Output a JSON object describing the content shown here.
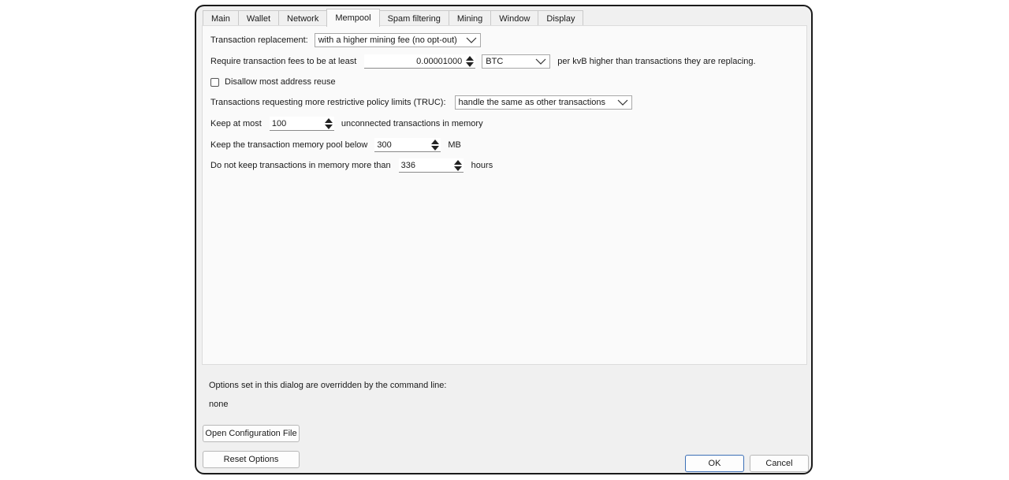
{
  "tabs": [
    {
      "label": "Main"
    },
    {
      "label": "Wallet"
    },
    {
      "label": "Network"
    },
    {
      "label": "Mempool",
      "active": true
    },
    {
      "label": "Spam filtering"
    },
    {
      "label": "Mining"
    },
    {
      "label": "Window"
    },
    {
      "label": "Display"
    }
  ],
  "mempool": {
    "replacement_label": "Transaction replacement:",
    "replacement_value": "with a higher mining fee (no opt-out)",
    "fee_label": "Require transaction fees to be at least",
    "fee_value": "0.00001000",
    "fee_unit": "BTC",
    "fee_suffix": "per kvB higher than transactions they are replacing.",
    "address_reuse_label": "Disallow most address reuse",
    "address_reuse_checked": false,
    "truc_label": "Transactions requesting more restrictive policy limits (TRUC):",
    "truc_value": "handle the same as other transactions",
    "keep_prefix": "Keep at most",
    "keep_value": "100",
    "keep_suffix": "unconnected transactions in memory",
    "pool_prefix": "Keep the transaction memory pool below",
    "pool_value": "300",
    "pool_suffix": "MB",
    "expiry_prefix": "Do not keep transactions in memory more than",
    "expiry_value": "336",
    "expiry_suffix": "hours"
  },
  "footer": {
    "override_note": "Options set in this dialog are overridden by the command line:",
    "override_value": "none",
    "open_config_label": "Open Configuration File",
    "reset_label": "Reset Options",
    "ok_label": "OK",
    "cancel_label": "Cancel"
  },
  "icons": {
    "dropdown": "chevron-down-icon",
    "spinner": "spin-arrows-icon"
  },
  "colors": {
    "dialog_bg": "#f0f0f0",
    "page_bg": "#fafafa",
    "default_button_border": "#3b6fb6"
  }
}
